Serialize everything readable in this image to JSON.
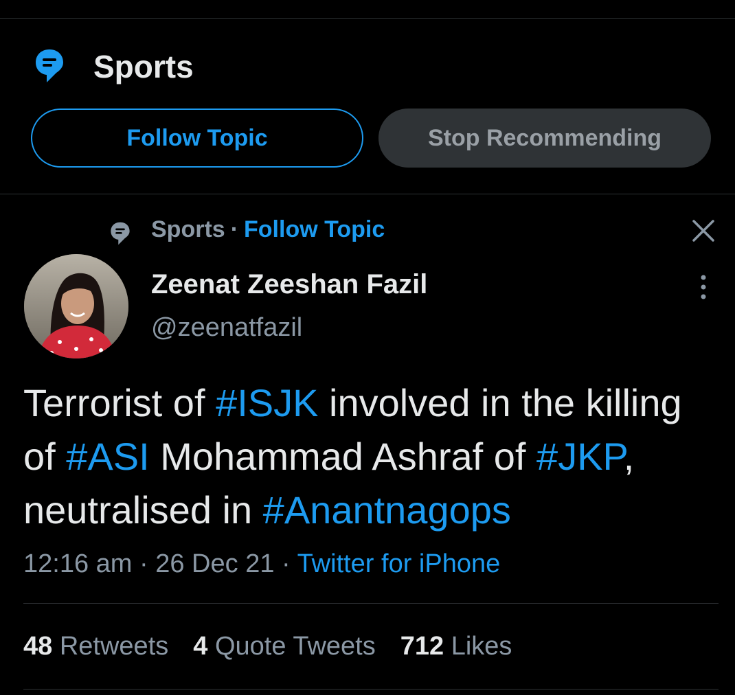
{
  "topic": {
    "title": "Sports",
    "follow_label": "Follow Topic",
    "stop_label": "Stop Recommending"
  },
  "context": {
    "topic": "Sports",
    "separator": "·",
    "follow": "Follow Topic"
  },
  "author": {
    "name": "Zeenat Zeeshan Fazil",
    "handle": "@zeenatfazil"
  },
  "tweet": {
    "t1": "Terrorist of ",
    "h1": "#ISJK",
    "t2": " involved in the killing of ",
    "h2": "#ASI",
    "t3": " Mohammad Ashraf of ",
    "h3": "#JKP",
    "t4": ", neutralised in ",
    "h4": "#Anantnagops"
  },
  "meta": {
    "time": "12:16 am",
    "sep1": " · ",
    "date": "26 Dec 21",
    "sep2": " · ",
    "source": "Twitter for iPhone"
  },
  "stats": {
    "retweets_num": "48",
    "retweets_label": "Retweets",
    "quotes_num": "4",
    "quotes_label": "Quote Tweets",
    "likes_num": "712",
    "likes_label": "Likes"
  },
  "colors": {
    "background": "#000000",
    "accent": "#1d9bf0",
    "text": "#e7e9ea",
    "muted": "#8b98a5",
    "divider": "#2f3336"
  },
  "icons": {
    "topic": "topic-bubble-icon",
    "close": "close-icon",
    "more": "more-vertical-icon"
  }
}
